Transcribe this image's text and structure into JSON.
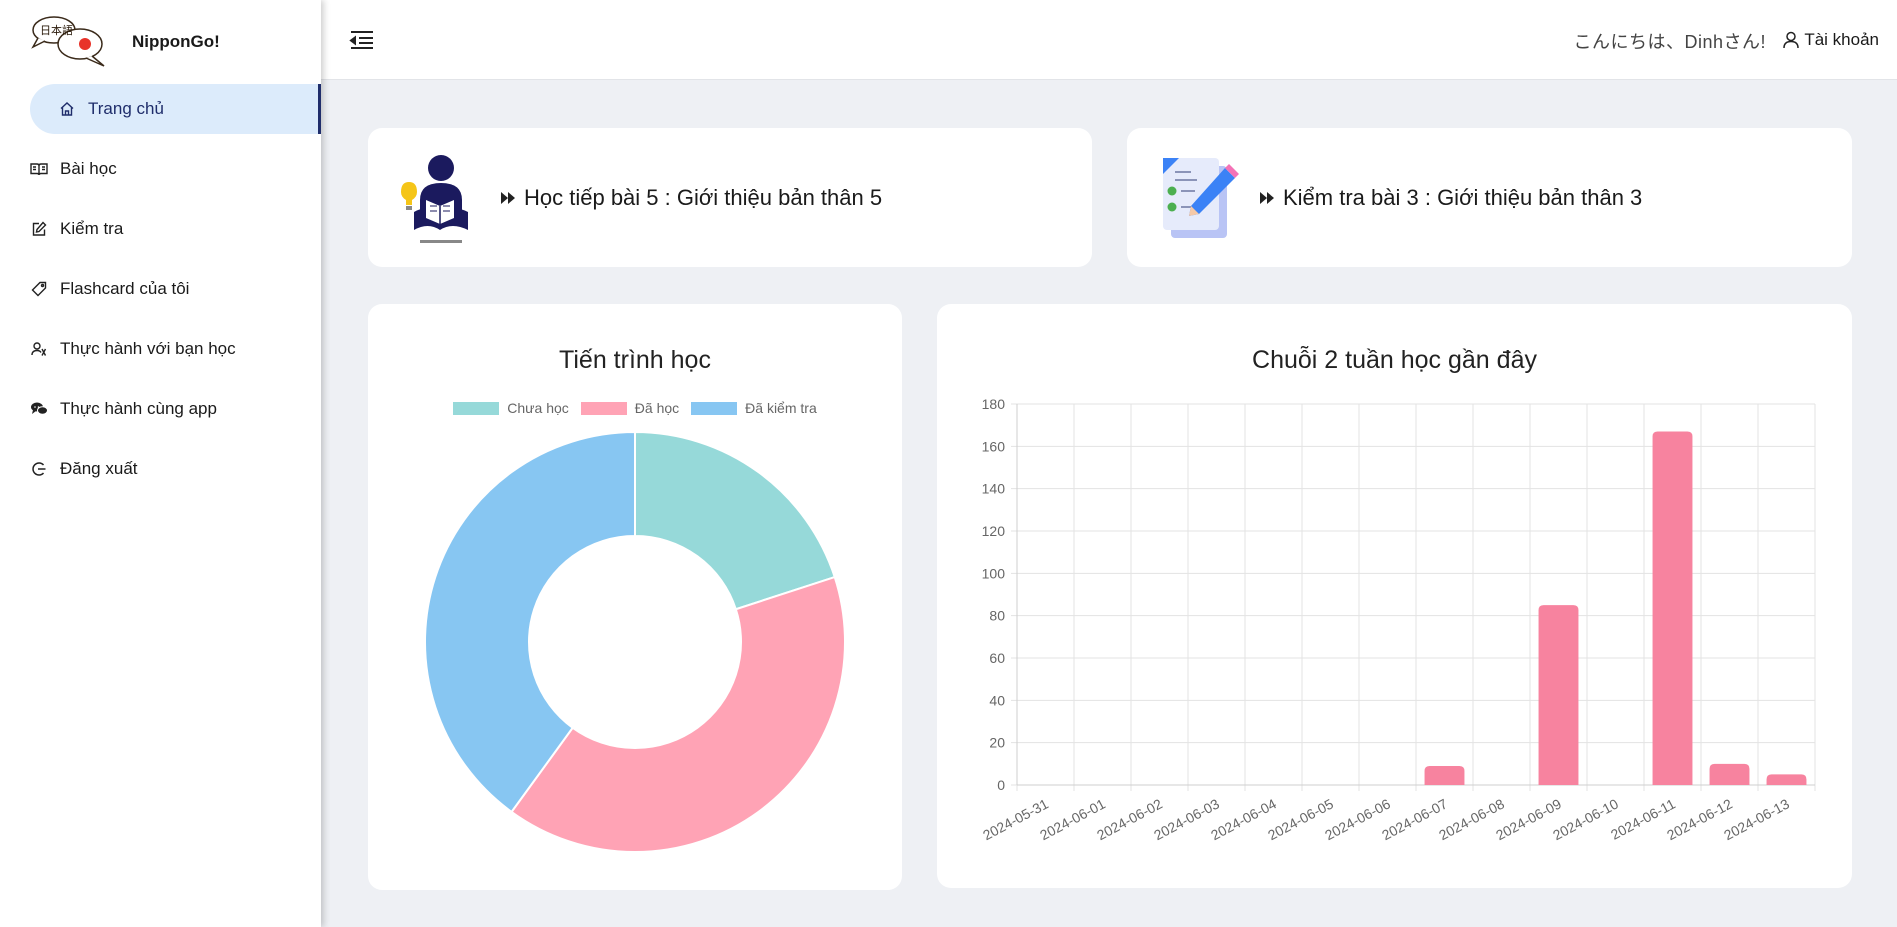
{
  "app": {
    "name": "NipponGo!",
    "logo_text": "日本語"
  },
  "sidebar": {
    "items": [
      {
        "label": "Trang chủ",
        "icon": "home-icon",
        "active": true
      },
      {
        "label": "Bài học",
        "icon": "book-icon"
      },
      {
        "label": "Kiểm tra",
        "icon": "edit-icon"
      },
      {
        "label": "Flashcard của tôi",
        "icon": "tag-icon"
      },
      {
        "label": "Thực hành với bạn học",
        "icon": "users-icon"
      },
      {
        "label": "Thực hành cùng app",
        "icon": "chat-icon"
      },
      {
        "label": "Đăng xuất",
        "icon": "logout-icon"
      }
    ]
  },
  "header": {
    "greeting": "こんにちは、Dinhさん!",
    "account_label": "Tài khoản"
  },
  "cards": {
    "continue_lesson": "Học tiếp bài 5 : Giới thiệu bản thân 5",
    "continue_test": "Kiểm tra bài 3 : Giới thiệu bản thân 3"
  },
  "colors": {
    "teal": "#96d9d9",
    "pink": "#ffa3b5",
    "blue": "#87c6f2",
    "bar": "#f7839f",
    "active_nav_bg": "#dcebfb",
    "active_nav_text": "#1f2d6b"
  },
  "chart_data": [
    {
      "type": "pie",
      "donut": true,
      "title": "Tiến trình học",
      "legend_position": "top",
      "categories": [
        "Chưa học",
        "Đã học",
        "Đã kiểm tra"
      ],
      "values": [
        20,
        40,
        40
      ],
      "colors": [
        "#96d9d9",
        "#ffa3b5",
        "#87c6f2"
      ]
    },
    {
      "type": "bar",
      "title": "Chuỗi 2 tuần học gần đây",
      "categories": [
        "2024-05-31",
        "2024-06-01",
        "2024-06-02",
        "2024-06-03",
        "2024-06-04",
        "2024-06-05",
        "2024-06-06",
        "2024-06-07",
        "2024-06-08",
        "2024-06-09",
        "2024-06-10",
        "2024-06-11",
        "2024-06-12",
        "2024-06-13"
      ],
      "values": [
        0,
        0,
        0,
        0,
        0,
        0,
        0,
        9,
        0,
        85,
        0,
        167,
        10,
        5
      ],
      "ylim": [
        0,
        180
      ],
      "yticks": [
        0,
        20,
        40,
        60,
        80,
        100,
        120,
        140,
        160,
        180
      ],
      "grid": true,
      "color": "#f7839f"
    }
  ]
}
